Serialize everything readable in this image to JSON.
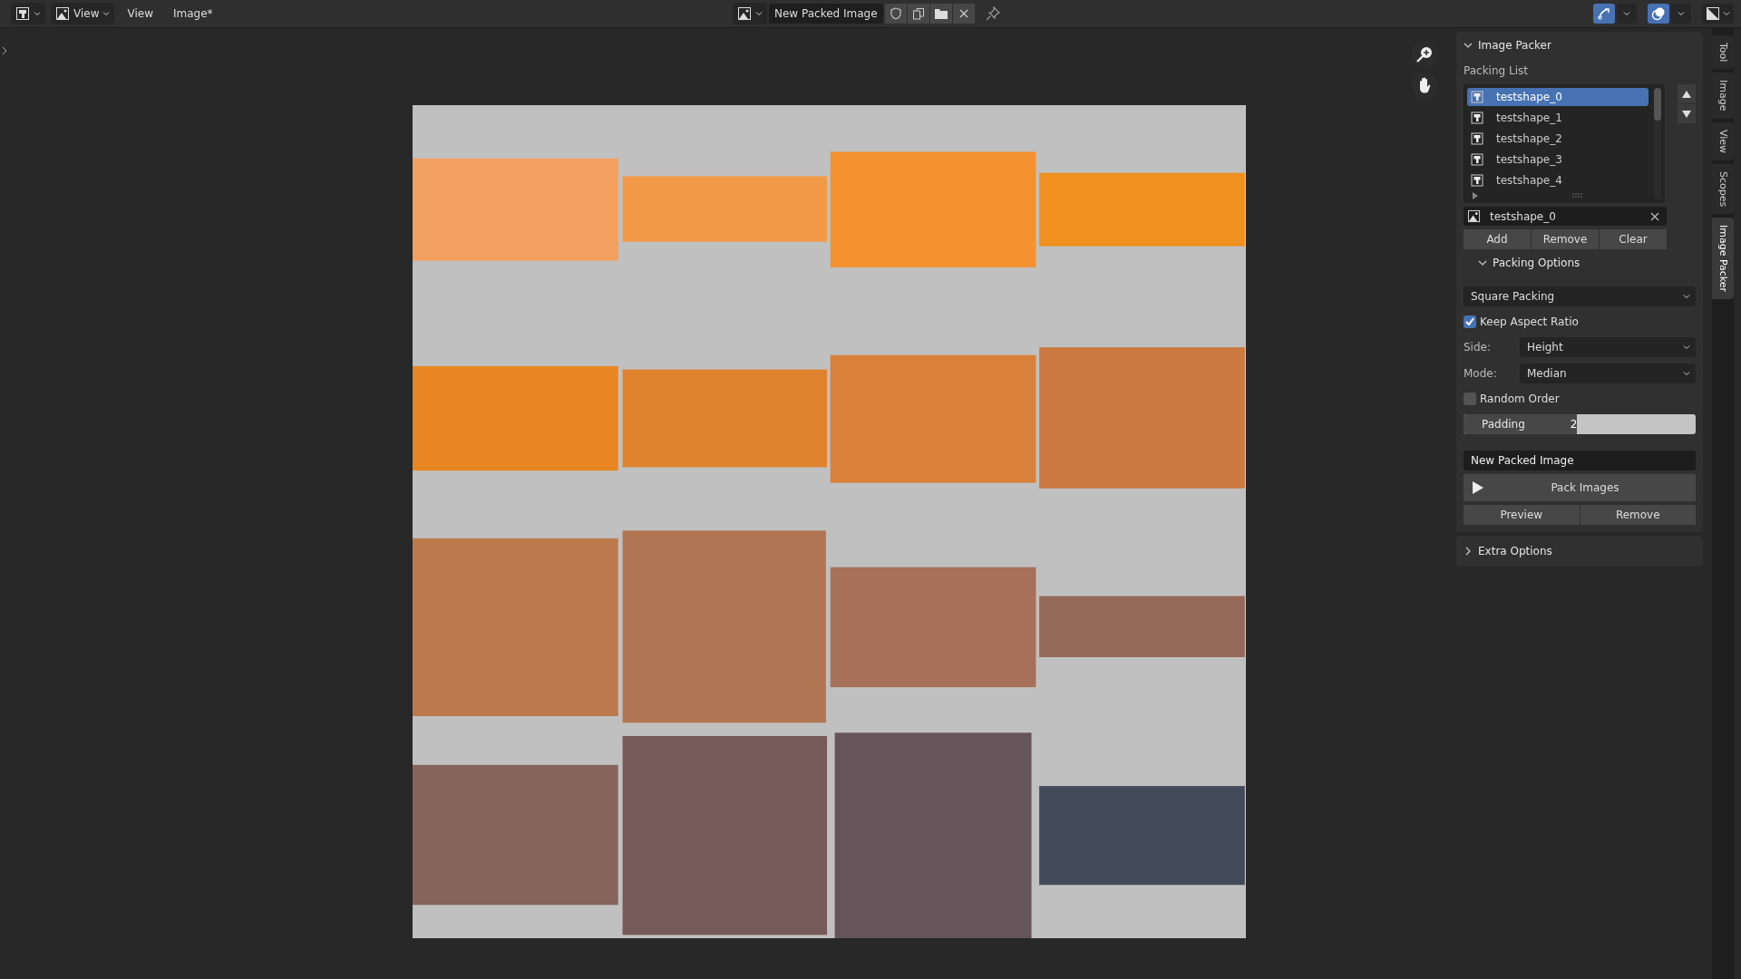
{
  "header": {
    "view_menu": "View",
    "menus": [
      "View",
      "Image*"
    ],
    "image_name": "New Packed Image"
  },
  "panel": {
    "title": "Image Packer",
    "expanded": true,
    "list_label": "Packing List",
    "items": [
      {
        "name": "testshape_0",
        "selected": true
      },
      {
        "name": "testshape_1",
        "selected": false
      },
      {
        "name": "testshape_2",
        "selected": false
      },
      {
        "name": "testshape_3",
        "selected": false
      },
      {
        "name": "testshape_4",
        "selected": false
      }
    ],
    "active_image": "testshape_0",
    "list_buttons": [
      "Add",
      "Remove",
      "Clear"
    ],
    "options": {
      "title": "Packing Options",
      "expanded": true,
      "method": "Square Packing",
      "keep_aspect": {
        "label": "Keep Aspect Ratio",
        "checked": true
      },
      "side": {
        "label": "Side:",
        "value": "Height"
      },
      "mode": {
        "label": "Mode:",
        "value": "Median"
      },
      "random_order": {
        "label": "Random Order",
        "checked": false
      },
      "padding": {
        "label": "Padding",
        "value": "2",
        "level": 0.49
      }
    },
    "output_name": "New Packed Image",
    "pack_button": "Pack Images",
    "bottom_buttons": [
      "Preview",
      "Remove"
    ],
    "extra": {
      "title": "Extra Options",
      "expanded": false
    }
  },
  "side_tabs": [
    {
      "label": "Tool",
      "selected": false
    },
    {
      "label": "Image",
      "selected": false
    },
    {
      "label": "View",
      "selected": false
    },
    {
      "label": "Scopes",
      "selected": false
    },
    {
      "label": "Image Packer",
      "selected": true
    }
  ]
}
